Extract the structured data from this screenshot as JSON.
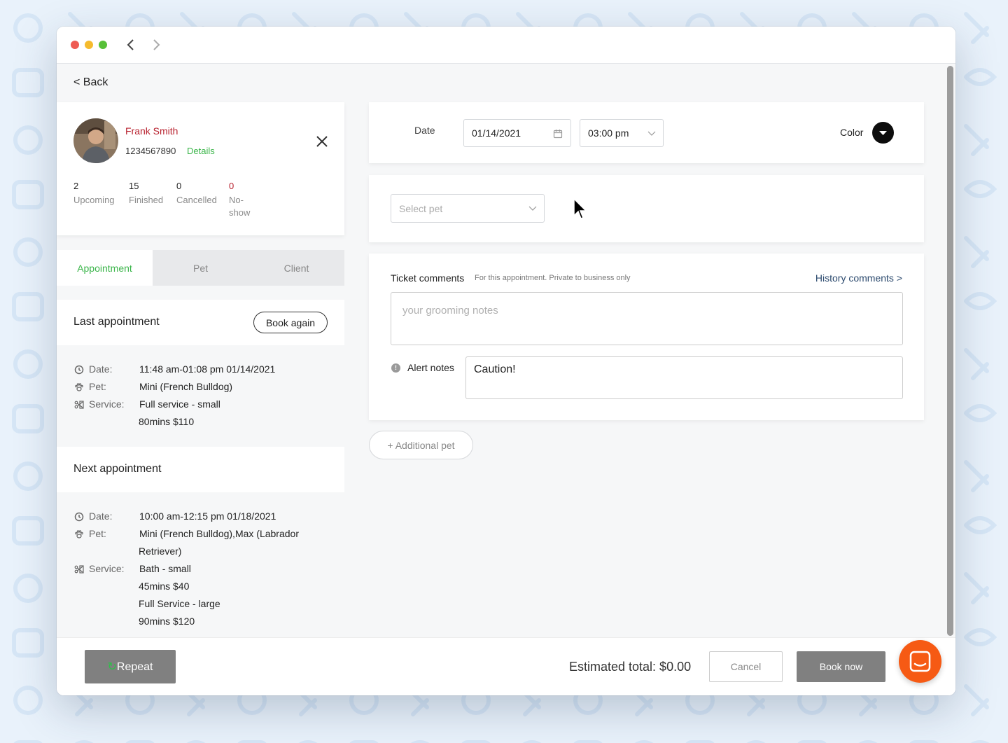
{
  "nav": {
    "back_label": "< Back"
  },
  "client": {
    "name": "Frank Smith",
    "phone": "1234567890",
    "details_label": "Details",
    "stats": [
      {
        "value": "2",
        "label": "Upcoming"
      },
      {
        "value": "15",
        "label": "Finished"
      },
      {
        "value": "0",
        "label": "Cancelled"
      },
      {
        "value": "0",
        "label": "No-show"
      }
    ]
  },
  "tabs": [
    {
      "label": "Appointment",
      "active": true
    },
    {
      "label": "Pet",
      "active": false
    },
    {
      "label": "Client",
      "active": false
    }
  ],
  "last_appointment": {
    "title": "Last appointment",
    "book_again_label": "Book again",
    "date_key": "Date:",
    "date": "11:48 am-01:08 pm 01/14/2021",
    "pet_key": "Pet:",
    "pet": "Mini (French Bulldog)",
    "service_key": "Service:",
    "service": "Full service - small",
    "service_detail": "80mins  $110"
  },
  "next_appointment": {
    "title": "Next appointment",
    "date_key": "Date:",
    "date": "10:00 am-12:15 pm 01/18/2021",
    "pet_key": "Pet:",
    "pet_line1": "Mini (French Bulldog),Max (Labrador",
    "pet_line2": "Retriever)",
    "service_key": "Service:",
    "service1": "Bath - small",
    "service1_detail": "45mins  $40",
    "service2": "Full Service - large",
    "service2_detail": "90mins  $120"
  },
  "booking": {
    "date_label": "Date",
    "date_value": "01/14/2021",
    "time_value": "03:00 pm",
    "color_label": "Color",
    "select_pet_placeholder": "Select pet",
    "ticket_comments_label": "Ticket comments",
    "ticket_comments_sub": "For this appointment. Private to business only",
    "history_link": "History comments >",
    "grooming_placeholder": "your grooming notes",
    "alert_label": "Alert notes",
    "alert_value": "Caution!",
    "additional_pet_label": "+ Additional pet"
  },
  "footer": {
    "repeat_label": "Repeat",
    "estimated_total": "Estimated total: $0.00",
    "cancel_label": "Cancel",
    "book_now_label": "Book now"
  },
  "colors": {
    "accent_green": "#3bb54a",
    "client_red": "#b8222f",
    "chat_orange": "#f65a14",
    "button_gray": "#808080"
  }
}
